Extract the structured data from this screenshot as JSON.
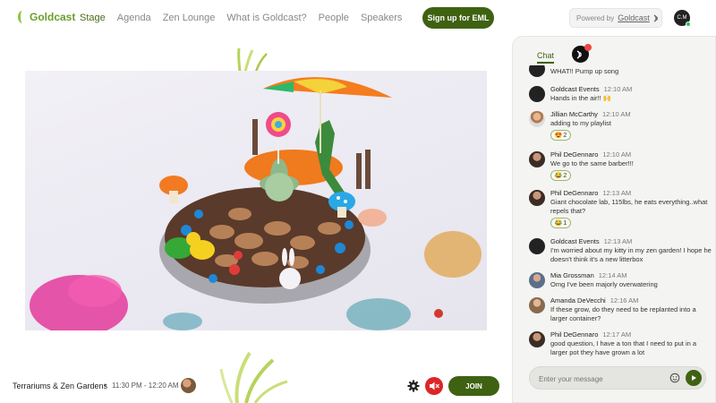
{
  "app": {
    "logo_text": "Goldcast",
    "accent_color": "#3f6212",
    "logo_color": "#6a9f2a"
  },
  "nav": {
    "items": [
      {
        "label": "Stage",
        "active": true
      },
      {
        "label": "Agenda",
        "active": false
      },
      {
        "label": "Zen Lounge",
        "active": false
      },
      {
        "label": "What is Goldcast?",
        "active": false
      },
      {
        "label": "People",
        "active": false
      },
      {
        "label": "Speakers",
        "active": false
      }
    ]
  },
  "header": {
    "signup_label": "Sign up for EML",
    "powered_by_label": "Powered by",
    "powered_by_brand": "Goldcast",
    "user_initials": "C.M"
  },
  "session": {
    "title": "Terrariums & Zen Gardens",
    "separator": "•",
    "time": "11:30 PM - 12:20 AM",
    "join_label": "JOIN",
    "mute_color": "#dc2626"
  },
  "chat": {
    "tab_label": "Chat",
    "input_placeholder": "Enter your message",
    "messages": [
      {
        "avatar": "av-gc",
        "name": "",
        "time": "",
        "text": "WHAT!! Pump up song",
        "reaction": null
      },
      {
        "avatar": "av-gc",
        "name": "Goldcast Events",
        "time": "12:10 AM",
        "text": "Hands in the air!! 🙌",
        "reaction": null
      },
      {
        "avatar": "av-jm",
        "name": "Jillian McCarthy",
        "time": "12:10 AM",
        "text": "adding to my playlist",
        "reaction": {
          "emoji": "😍",
          "count": "2"
        }
      },
      {
        "avatar": "av-pd",
        "name": "Phil DeGennaro",
        "time": "12:10 AM",
        "text": "We go to the same barber!!!",
        "reaction": {
          "emoji": "😂",
          "count": "2"
        }
      },
      {
        "avatar": "av-pd",
        "name": "Phil DeGennaro",
        "time": "12:13 AM",
        "text": "Giant chocolate lab, 115lbs, he eats everything..what repels that?",
        "reaction": {
          "emoji": "😂",
          "count": "1"
        }
      },
      {
        "avatar": "av-gc",
        "name": "Goldcast Events",
        "time": "12:13 AM",
        "text": "I'm worried about my kitty in my zen garden! I hope he doesn't think it's a new litterbox",
        "reaction": null
      },
      {
        "avatar": "av-mg",
        "name": "Mia Grossman",
        "time": "12:14 AM",
        "text": "Omg I've been majorly overwatering",
        "reaction": null
      },
      {
        "avatar": "av-ad",
        "name": "Amanda DeVecchi",
        "time": "12:16 AM",
        "text": "If these grow, do they need to be replanted into a larger container?",
        "reaction": null
      },
      {
        "avatar": "av-pd",
        "name": "Phil DeGennaro",
        "time": "12:17 AM",
        "text": "good question, I have a ton that I need to put in a larger pot they have grown a lot",
        "reaction": null
      }
    ]
  }
}
